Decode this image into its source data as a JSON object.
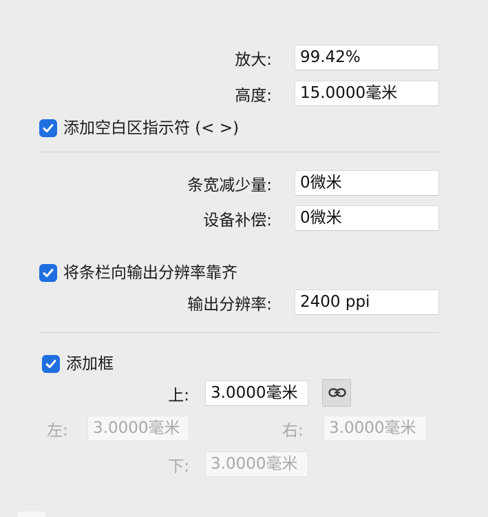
{
  "magnification": {
    "label": "放大:",
    "value": "99.42%"
  },
  "height": {
    "label": "高度:",
    "value": "15.0000毫米"
  },
  "add_quiet_zone": {
    "label": "添加空白区指示符 (< >)",
    "checked": true
  },
  "bar_width_reduction": {
    "label": "条宽减少量:",
    "value": "0微米"
  },
  "device_compensation": {
    "label": "设备补偿:",
    "value": "0微米"
  },
  "align_bars": {
    "label": "将条栏向输出分辨率靠齐",
    "checked": true
  },
  "output_resolution": {
    "label": "输出分辨率:",
    "value": "2400 ppi"
  },
  "add_border": {
    "label": "添加框",
    "checked": true
  },
  "border": {
    "top": {
      "label": "上:",
      "value": "3.0000毫米"
    },
    "left": {
      "label": "左:",
      "value": "3.0000毫米"
    },
    "right": {
      "label": "右:",
      "value": "3.0000毫米"
    },
    "bottom": {
      "label": "下:",
      "value": "3.0000毫米"
    },
    "link_icon": "link-icon"
  },
  "colors": {
    "accent": "#1f6fe0",
    "background": "#ececec",
    "disabled_text": "#a9a9a9"
  }
}
